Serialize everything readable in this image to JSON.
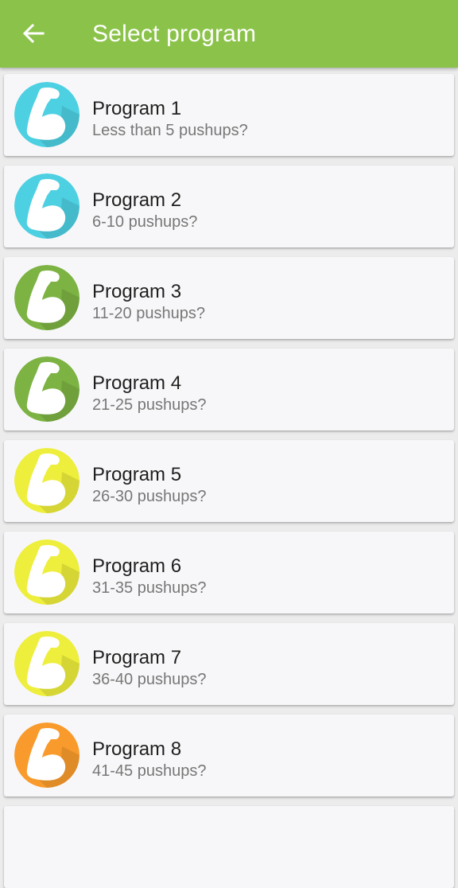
{
  "appbar": {
    "title": "Select program",
    "back_icon": "arrow-left-icon",
    "color": "#8bc34a"
  },
  "programs": [
    {
      "title": "Program 1",
      "subtitle": "Less than 5 pushups?",
      "icon": "flexed-arm-icon",
      "color": "#4dd0e1"
    },
    {
      "title": "Program 2",
      "subtitle": "6-10 pushups?",
      "icon": "flexed-arm-icon",
      "color": "#4dd0e1"
    },
    {
      "title": "Program 3",
      "subtitle": "11-20 pushups?",
      "icon": "flexed-arm-icon",
      "color": "#7cb342"
    },
    {
      "title": "Program 4",
      "subtitle": "21-25 pushups?",
      "icon": "flexed-arm-icon",
      "color": "#7cb342"
    },
    {
      "title": "Program 5",
      "subtitle": "26-30 pushups?",
      "icon": "flexed-arm-icon",
      "color": "#eeee3c"
    },
    {
      "title": "Program 6",
      "subtitle": "31-35 pushups?",
      "icon": "flexed-arm-icon",
      "color": "#eeee3c"
    },
    {
      "title": "Program 7",
      "subtitle": "36-40 pushups?",
      "icon": "flexed-arm-icon",
      "color": "#eeee3c"
    },
    {
      "title": "Program 8",
      "subtitle": "41-45 pushups?",
      "icon": "flexed-arm-icon",
      "color": "#f99b2c"
    }
  ]
}
